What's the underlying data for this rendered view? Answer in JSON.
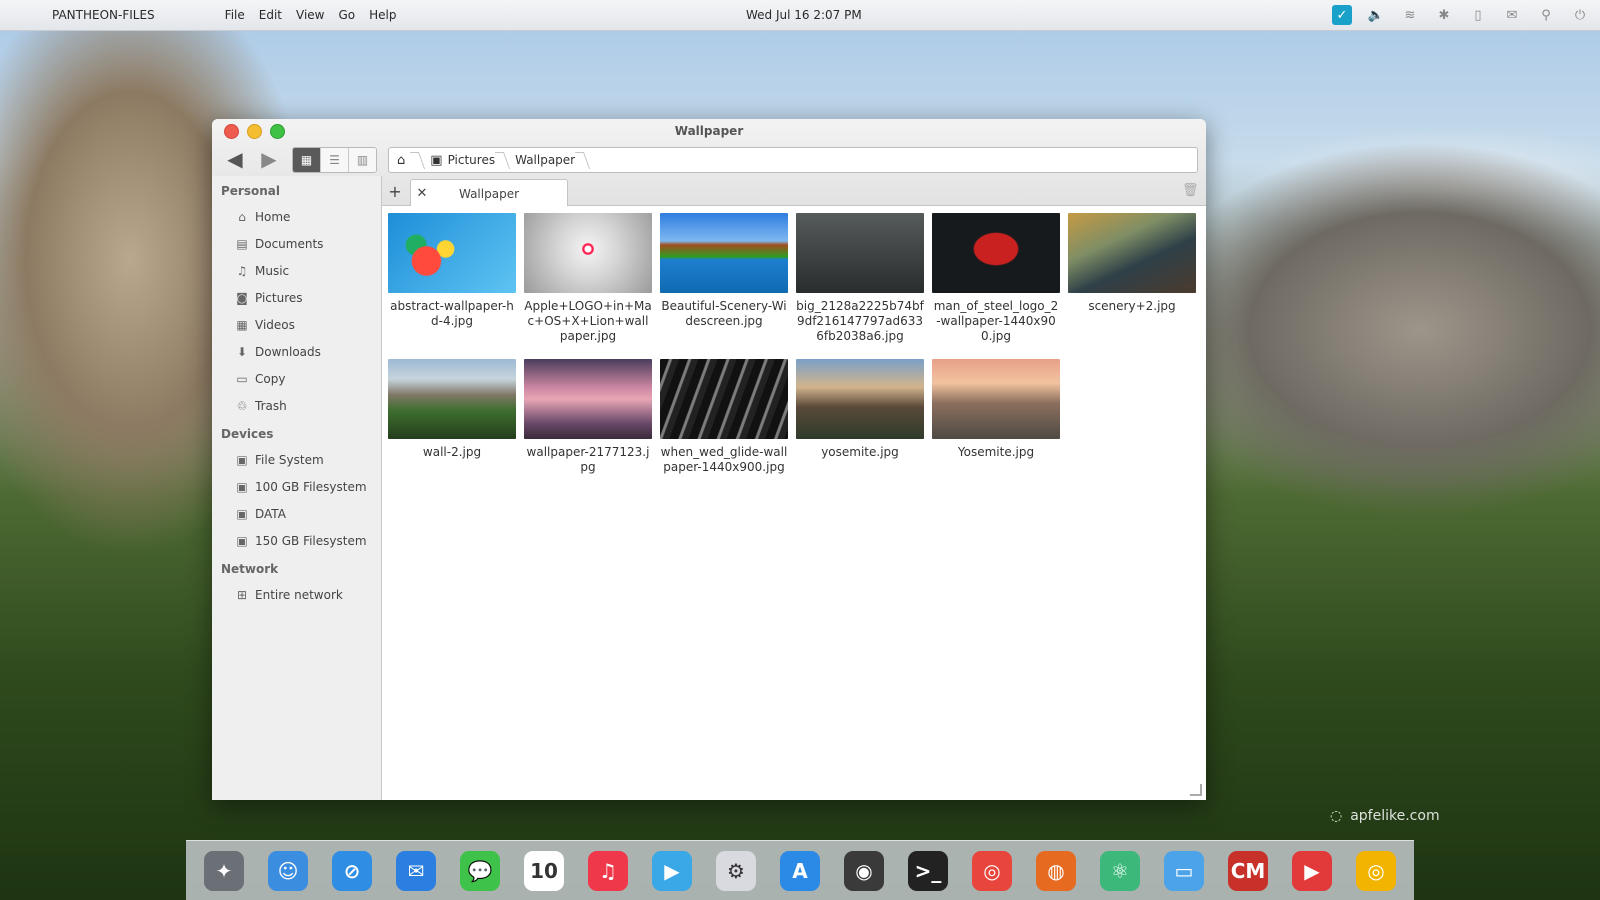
{
  "menubar": {
    "app_name": "PANTHEON-FILES",
    "menus": [
      "File",
      "Edit",
      "View",
      "Go",
      "Help"
    ],
    "clock": "Wed Jul 16  2:07 PM"
  },
  "window": {
    "title": "Wallpaper",
    "path": [
      "Pictures",
      "Wallpaper"
    ],
    "tab_label": "Wallpaper"
  },
  "sidebar": {
    "sections": [
      {
        "title": "Personal",
        "items": [
          {
            "label": "Home",
            "icon": "home-icon"
          },
          {
            "label": "Documents",
            "icon": "documents-icon"
          },
          {
            "label": "Music",
            "icon": "music-icon"
          },
          {
            "label": "Pictures",
            "icon": "pictures-icon"
          },
          {
            "label": "Videos",
            "icon": "videos-icon"
          },
          {
            "label": "Downloads",
            "icon": "downloads-icon"
          },
          {
            "label": "Copy",
            "icon": "folder-icon"
          },
          {
            "label": "Trash",
            "icon": "trash-icon"
          }
        ]
      },
      {
        "title": "Devices",
        "items": [
          {
            "label": "File System",
            "icon": "drive-icon"
          },
          {
            "label": "100 GB Filesystem",
            "icon": "drive-icon"
          },
          {
            "label": "DATA",
            "icon": "drive-icon"
          },
          {
            "label": "150 GB Filesystem",
            "icon": "drive-icon"
          }
        ]
      },
      {
        "title": "Network",
        "items": [
          {
            "label": "Entire network",
            "icon": "network-icon"
          }
        ]
      }
    ]
  },
  "files": [
    {
      "name": "abstract-wallpaper-hd-4.jpg"
    },
    {
      "name": "Apple+LOGO+in+Mac+OS+X+Lion+wallpaper.jpg"
    },
    {
      "name": "Beautiful-Scenery-Widescreen.jpg"
    },
    {
      "name": "big_2128a2225b74bf9df216147797ad6336fb2038a6.jpg"
    },
    {
      "name": "man_of_steel_logo_2-wallpaper-1440x900.jpg"
    },
    {
      "name": "scenery+2.jpg"
    },
    {
      "name": "wall-2.jpg"
    },
    {
      "name": "wallpaper-2177123.jpg"
    },
    {
      "name": "when_wed_glide-wallpaper-1440x900.jpg"
    },
    {
      "name": "yosemite.jpg"
    },
    {
      "name": "Yosemite.jpg"
    }
  ],
  "dock": {
    "items": [
      {
        "icon": "rocket-launcher-icon",
        "color": "#6b6f76",
        "glyph": "✦"
      },
      {
        "icon": "finder-icon",
        "color": "#3b8de0",
        "glyph": "☺"
      },
      {
        "icon": "safari-icon",
        "color": "#2f8de4",
        "glyph": "⊘"
      },
      {
        "icon": "mail-icon",
        "color": "#2b7fe0",
        "glyph": "✉"
      },
      {
        "icon": "messages-icon",
        "color": "#3fc24a",
        "glyph": "💬"
      },
      {
        "icon": "calendar-icon",
        "color": "#ffffff",
        "glyph": "10"
      },
      {
        "icon": "music-icon",
        "color": "#f0384b",
        "glyph": "♫"
      },
      {
        "icon": "video-editor-icon",
        "color": "#3aa7e6",
        "glyph": "▶"
      },
      {
        "icon": "settings-toggle-icon",
        "color": "#d9d9e0",
        "glyph": "⚙"
      },
      {
        "icon": "app-store-icon",
        "color": "#2a8ae6",
        "glyph": "A"
      },
      {
        "icon": "camera-icon",
        "color": "#3a3a3a",
        "glyph": "◉"
      },
      {
        "icon": "terminal-icon",
        "color": "#222222",
        "glyph": ">_"
      },
      {
        "icon": "chrome-icon",
        "color": "#e8453c",
        "glyph": "◎"
      },
      {
        "icon": "firefox-icon",
        "color": "#e66a1f",
        "glyph": "◍"
      },
      {
        "icon": "atom-icon",
        "color": "#3cb87a",
        "glyph": "⚛"
      },
      {
        "icon": "desktop-icon",
        "color": "#4da3e8",
        "glyph": "▭"
      },
      {
        "icon": "cm-icon",
        "color": "#c8312a",
        "glyph": "CM"
      },
      {
        "icon": "media-player-icon",
        "color": "#e23a3a",
        "glyph": "▶"
      },
      {
        "icon": "chrome-alt-icon",
        "color": "#f2b400",
        "glyph": "◎"
      }
    ]
  },
  "watermark": "apfelike.com"
}
